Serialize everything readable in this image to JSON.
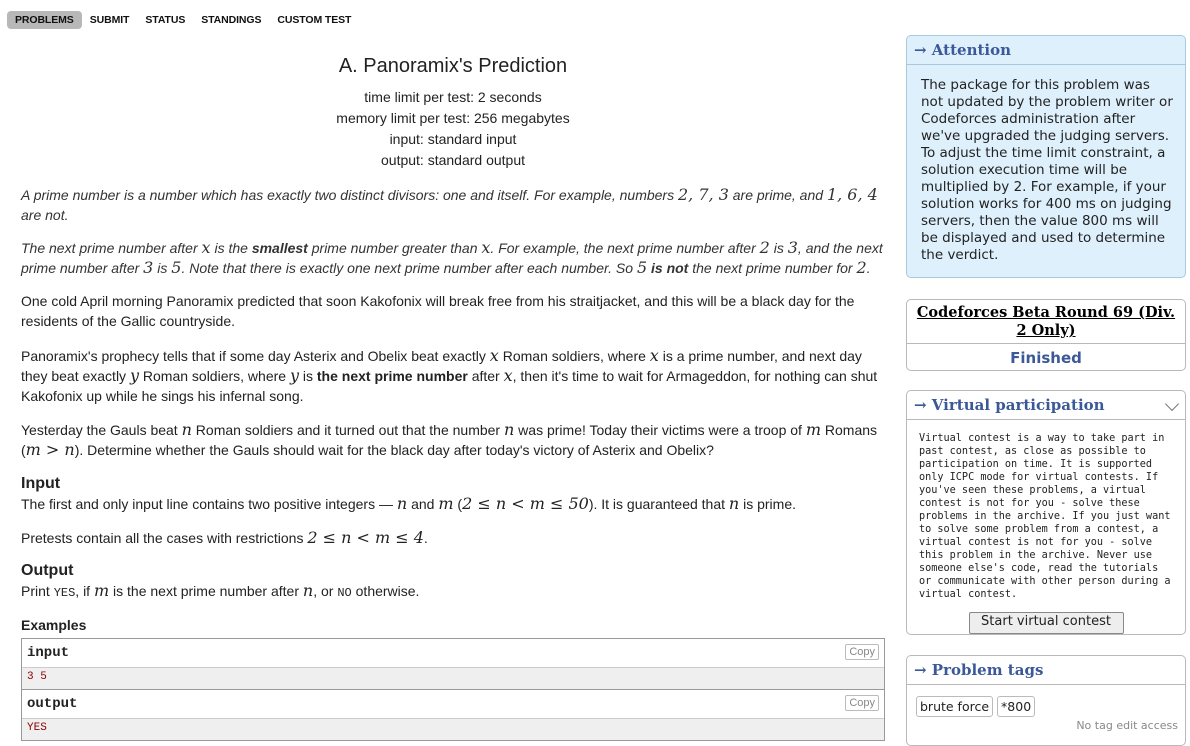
{
  "nav": {
    "items": [
      {
        "label": "Problems",
        "active": true
      },
      {
        "label": "Submit",
        "active": false
      },
      {
        "label": "Status",
        "active": false
      },
      {
        "label": "Standings",
        "active": false
      },
      {
        "label": "Custom test",
        "active": false
      }
    ]
  },
  "problem": {
    "title": "A. Panoramix's Prediction",
    "time_limit": "time limit per test: 2 seconds",
    "memory_limit": "memory limit per test: 256 megabytes",
    "input": "input: standard input",
    "output": "output: standard output",
    "legend": {
      "p1": {
        "t1": "A prime number is a number which has exactly two distinct divisors: one and itself. For example, numbers ",
        "m1": "2, 7, 3",
        "t2": " are prime, and ",
        "m2": "1, 6, 4",
        "t3": " are not."
      },
      "p2": {
        "t1": "The next prime number after ",
        "m1": "x",
        "t2": " is the ",
        "b1": "smallest",
        "t3": " prime number greater than ",
        "m2": "x",
        "t4": ". For example, the next prime number after ",
        "m3": "2",
        "t5": " is ",
        "m4": "3",
        "t6": ", and the next prime number after ",
        "m5": "3",
        "t7": " is ",
        "m6": "5",
        "t8": ". Note that there is exactly one next prime number after each number. So ",
        "m7": "5",
        "t9": " ",
        "b2": "is not",
        "t10": " the next prime number for ",
        "m8": "2",
        "t11": "."
      },
      "p3": "One cold April morning Panoramix predicted that soon Kakofonix will break free from his straitjacket, and this will be a black day for the residents of the Gallic countryside.",
      "p4": {
        "t1": "Panoramix's prophecy tells that if some day Asterix and Obelix beat exactly ",
        "m1": "x",
        "t2": " Roman soldiers, where ",
        "m2": "x",
        "t3": " is a prime number, and next day they beat exactly ",
        "m3": "y",
        "t4": " Roman soldiers, where ",
        "m4": "y",
        "t5": " is ",
        "b1": "the next prime number",
        "t6": " after ",
        "m5": "x",
        "t7": ", then it's time to wait for Armageddon, for nothing can shut Kakofonix up while he sings his infernal song."
      },
      "p5": {
        "t1": "Yesterday the Gauls beat ",
        "m1": "n",
        "t2": " Roman soldiers and it turned out that the number ",
        "m2": "n",
        "t3": " was prime! Today their victims were a troop of ",
        "m3": "m",
        "t4": " Romans (",
        "m4": "m > n",
        "t5": "). Determine whether the Gauls should wait for the black day after today's victory of Asterix and Obelix?"
      }
    },
    "input_spec": {
      "title": "Input",
      "p1": {
        "t1": "The first and only input line contains two positive integers — ",
        "m1": "n",
        "t2": " and ",
        "m2": "m",
        "t3": " (",
        "m3": "2 ≤ n < m ≤ 50",
        "t4": "). It is guaranteed that ",
        "m4": "n",
        "t5": " is prime."
      },
      "p2": {
        "t1": "Pretests contain all the cases with restrictions ",
        "m1": "2 ≤ n < m ≤ 4",
        "t2": "."
      }
    },
    "output_spec": {
      "title": "Output",
      "t1": "Print ",
      "c1": "YES",
      "t2": ", if ",
      "m1": "m",
      "t3": " is the next prime number after ",
      "m2": "n",
      "t4": ", or ",
      "c2": "NO",
      "t5": " otherwise."
    },
    "examples": {
      "title": "Examples",
      "input_label": "input",
      "output_label": "output",
      "copy_label": "Copy",
      "input_value": "3 5",
      "output_value": "YES"
    }
  },
  "sidebar": {
    "attention": {
      "title": "→ Attention",
      "body": "The package for this problem was not updated by the problem writer or Codeforces administration after we've upgraded the judging servers. To adjust the time limit constraint, a solution execution time will be multiplied by 2. For example, if your solution works for 400 ms on judging servers, then the value 800 ms will be displayed and used to determine the verdict."
    },
    "contest": {
      "name": "Codeforces Beta Round 69 (Div. 2 Only)",
      "phase": "Finished"
    },
    "virtual": {
      "title": "→ Virtual participation",
      "body": "Virtual contest is a way to take part in past contest, as close as possible to participation on time. It is supported only ICPC mode for virtual contests. If you've seen these problems, a virtual contest is not for you - solve these problems in the archive. If you just want to solve some problem from a contest, a virtual contest is not for you - solve this problem in the archive. Never use someone else's code, read the tutorials or communicate with other person during a virtual contest.",
      "button": "Start virtual contest"
    },
    "tags": {
      "title": "→ Problem tags",
      "items": [
        "brute force",
        "*800"
      ],
      "note": "No tag edit access"
    }
  }
}
